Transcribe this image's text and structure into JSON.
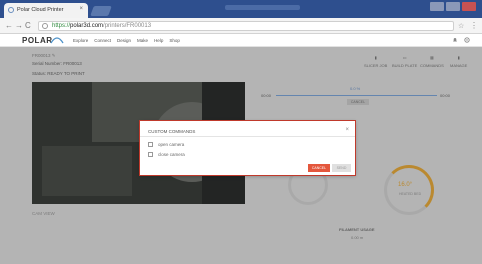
{
  "browser": {
    "tab_title": "Polar Cloud Printer",
    "tab_close": "×",
    "url_https": "https://",
    "url_host": "polar3d.com",
    "url_path": "/printers/FR00013"
  },
  "site": {
    "logo": "POLAR",
    "nav": [
      "Explore",
      "Connect",
      "Design",
      "Make",
      "Help",
      "Shop"
    ]
  },
  "printer": {
    "name": "FR00013",
    "serial": "Serial Number: FR00013",
    "status": "Status: READY TO PRINT"
  },
  "toolbar": [
    "SLICER JOB",
    "BUILD PLATE",
    "COMMANDS",
    "MANAGE"
  ],
  "camera_label": "CAM VIEW",
  "progress": {
    "percent": "0.0 %",
    "start_time": "00:00",
    "end_time": "00:00",
    "cancel_label": "CANCEL"
  },
  "temperature": {
    "value": "16.0°",
    "label": "HEATED BED"
  },
  "filament": {
    "title": "FILAMENT USAGE",
    "value": "0.00 m"
  },
  "modal": {
    "title": "CUSTOM COMMANDS",
    "close": "×",
    "commands": [
      "open camera",
      "close camera"
    ],
    "cancel_label": "CANCEL",
    "send_label": "SEND"
  },
  "colors": {
    "accent": "#e4573d",
    "header_bar": "#2e4f8e",
    "temp_ring": "#e3a83b",
    "progress": "#7aa3d6"
  }
}
